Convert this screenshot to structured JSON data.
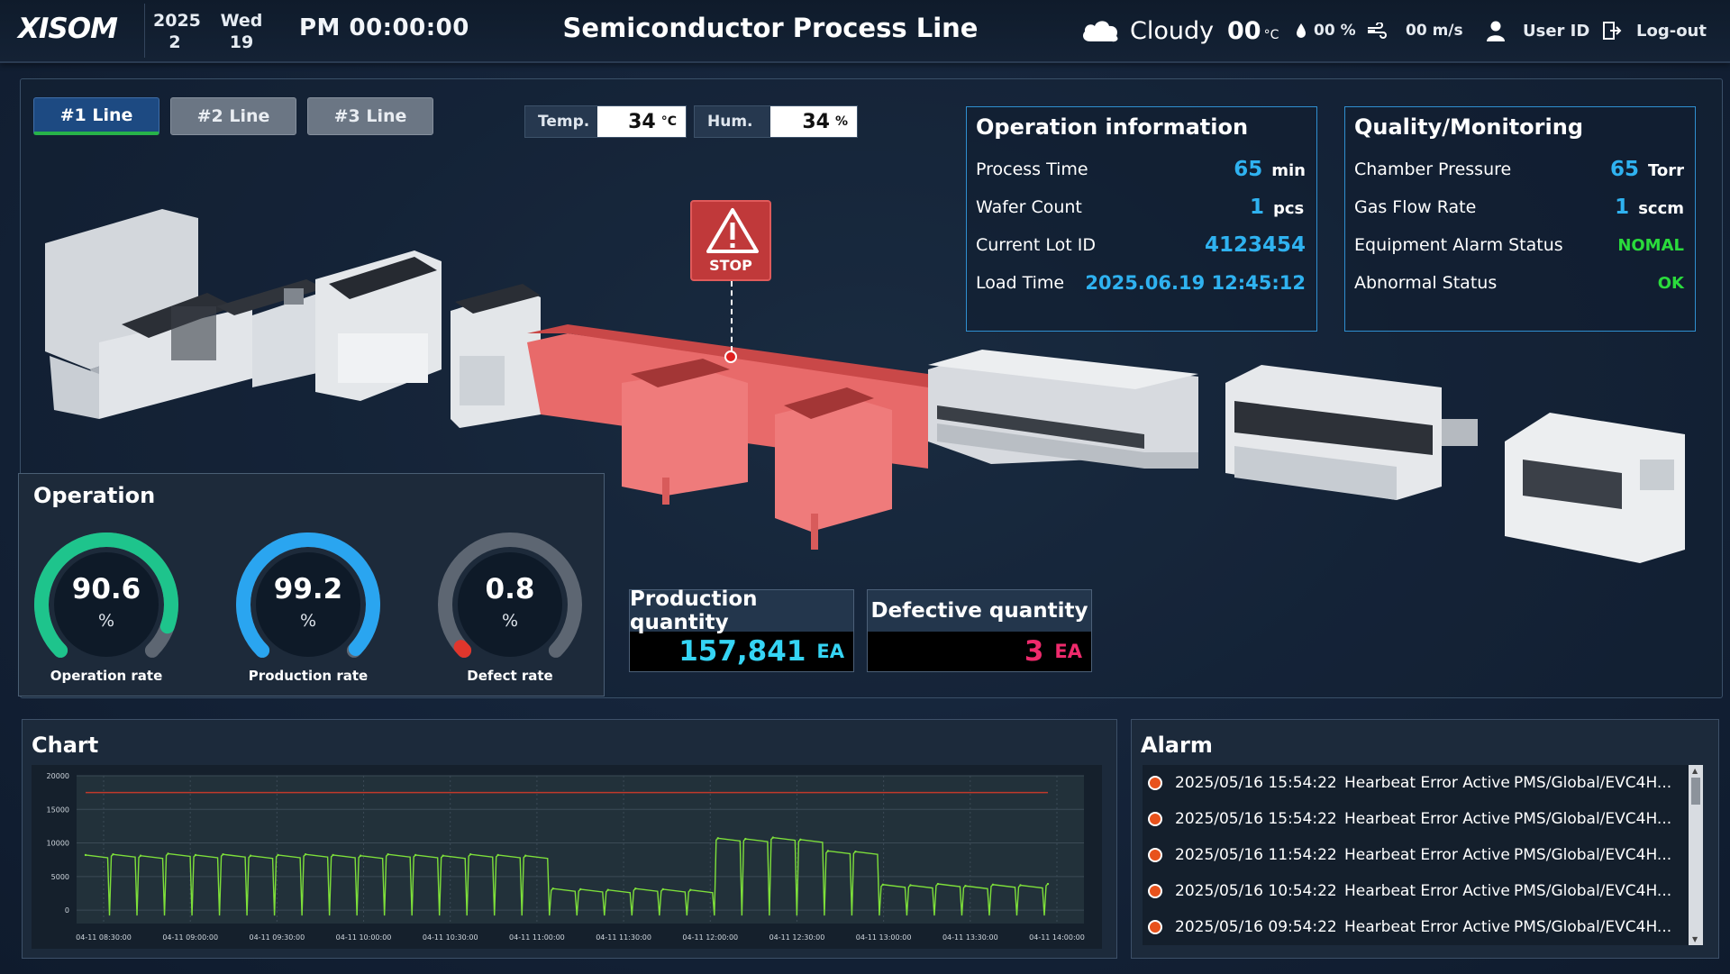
{
  "header": {
    "logo": "XISOM",
    "year": "2025",
    "month": "2",
    "weekday": "Wed",
    "day": "19",
    "clock": "PM 00:00:00",
    "title": "Semiconductor Process Line",
    "weather": "Cloudy",
    "temp_value": "00",
    "temp_unit": "°C",
    "humidity": "00 %",
    "wind": "00 m/s",
    "user_label": "User ID",
    "logout_label": "Log-out"
  },
  "lines": [
    {
      "label": "#1 Line",
      "active": true
    },
    {
      "label": "#2 Line",
      "active": false
    },
    {
      "label": "#3 Line",
      "active": false
    }
  ],
  "sensors": {
    "temp_label": "Temp.",
    "temp_value": "34",
    "temp_unit": "°C",
    "hum_label": "Hum.",
    "hum_value": "34",
    "hum_unit": "%"
  },
  "stop_label": "STOP",
  "operation_info": {
    "title": "Operation information",
    "rows": [
      {
        "label": "Process Time",
        "value": "65",
        "unit": "min"
      },
      {
        "label": "Wafer Count",
        "value": "1",
        "unit": "pcs"
      },
      {
        "label": "Current Lot ID",
        "value": "4123454",
        "unit": ""
      },
      {
        "label": "Load Time",
        "value": "2025.06.19 12:45:12",
        "unit": ""
      }
    ]
  },
  "quality": {
    "title": "Quality/Monitoring",
    "rows": [
      {
        "label": "Chamber Pressure",
        "value": "65",
        "unit": "Torr"
      },
      {
        "label": "Gas Flow Rate",
        "value": "1",
        "unit": "sccm"
      },
      {
        "label": "Equipment Alarm Status",
        "value": "NOMAL"
      },
      {
        "label": "Abnormal Status",
        "value": "OK"
      }
    ]
  },
  "operation": {
    "title": "Operation",
    "gauges": [
      {
        "label": "Operation rate",
        "value": "90.6",
        "unit": "%",
        "percent": 90.6,
        "color": "#1ec48c"
      },
      {
        "label": "Production rate",
        "value": "99.2",
        "unit": "%",
        "percent": 99.2,
        "color": "#2aa5f0"
      },
      {
        "label": "Defect rate",
        "value": "0.8",
        "unit": "%",
        "percent": 0.8,
        "color": "#e0362c"
      }
    ]
  },
  "production": {
    "label": "Production quantity",
    "value": "157,841",
    "unit": "EA",
    "color": "#35d4f4"
  },
  "defective": {
    "label": "Defective quantity",
    "value": "3",
    "unit": "EA",
    "color": "#ef2a6c"
  },
  "chart": {
    "title": "Chart"
  },
  "chart_data": {
    "type": "line",
    "title": "",
    "xlabel": "",
    "ylabel": "",
    "ylim": [
      -2000,
      20000
    ],
    "yticks": [
      "0",
      "5000",
      "10000",
      "15000",
      "20000"
    ],
    "xticks": [
      "04-11 08:30:00",
      "04-11 09:00:00",
      "04-11 09:30:00",
      "04-11 10:00:00",
      "04-11 10:30:00",
      "04-11 11:00:00",
      "04-11 11:30:00",
      "04-11 12:00:00",
      "04-11 12:30:00",
      "04-11 13:00:00",
      "04-11 13:30:00",
      "04-11 14:00:00"
    ],
    "threshold": 17500,
    "threshold_color": "#c0392b",
    "series_color": "#7ee03a",
    "x": [
      "08:15",
      "08:25",
      "08:35",
      "08:45",
      "08:55",
      "09:05",
      "09:15",
      "09:25",
      "09:35",
      "09:45",
      "09:55",
      "10:05",
      "10:15",
      "10:25",
      "10:35",
      "10:45",
      "10:55",
      "11:00",
      "11:10",
      "11:20",
      "11:30",
      "11:40",
      "11:50",
      "12:00",
      "12:10",
      "12:20",
      "12:30",
      "12:40",
      "12:50",
      "13:00",
      "13:10",
      "13:20",
      "13:30",
      "13:40",
      "13:50",
      "14:00"
    ],
    "values": [
      8200,
      8300,
      8100,
      8400,
      8200,
      8300,
      8100,
      8200,
      8300,
      8200,
      8100,
      8300,
      8200,
      8100,
      8300,
      8200,
      8100,
      3200,
      3100,
      3000,
      3200,
      3100,
      3000,
      10700,
      10600,
      10800,
      10500,
      8800,
      8700,
      3800,
      3700,
      3900,
      3600,
      3800,
      3700,
      3900
    ]
  },
  "alarm": {
    "title": "Alarm",
    "rows": [
      {
        "time": "2025/05/16 15:54:22",
        "event": "Hearbeat Error Active",
        "source": "PMS/Global/EVC4H..."
      },
      {
        "time": "2025/05/16 15:54:22",
        "event": "Hearbeat Error Active",
        "source": "PMS/Global/EVC4H..."
      },
      {
        "time": "2025/05/16 11:54:22",
        "event": "Hearbeat Error Active",
        "source": "PMS/Global/EVC4H..."
      },
      {
        "time": "2025/05/16 10:54:22",
        "event": "Hearbeat Error Active",
        "source": "PMS/Global/EVC4H..."
      },
      {
        "time": "2025/05/16 09:54:22",
        "event": "Hearbeat Error Active",
        "source": "PMS/Global/EVC4H..."
      }
    ]
  }
}
